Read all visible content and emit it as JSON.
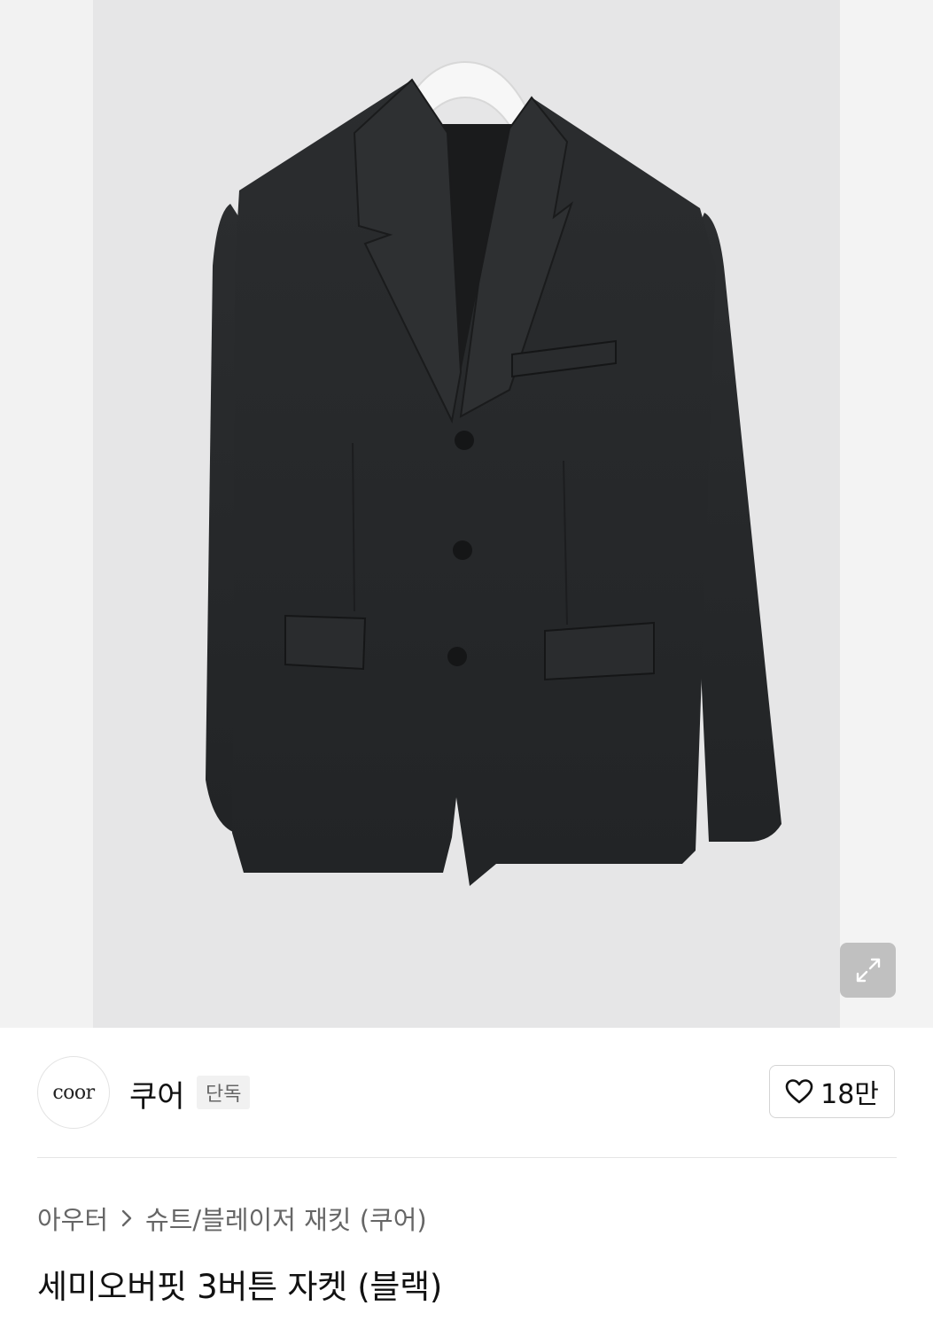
{
  "product": {
    "brand": {
      "logo_text": "coor",
      "name": "쿠어",
      "badge": "단독"
    },
    "like": {
      "count": "18만",
      "icon": "heart-outline-icon"
    },
    "breadcrumb": {
      "items": [
        "아우터",
        "슈트/블레이저 재킷 (쿠어)"
      ],
      "separator_icon": "chevron-right-icon"
    },
    "title": "세미오버핏 3버튼 자켓 (블랙)",
    "image": {
      "expand_icon": "expand-arrows-icon"
    }
  },
  "colors": {
    "jacket": "#26282a",
    "background": "#e6e6e7",
    "text_primary": "#111111",
    "text_secondary": "#666666"
  }
}
